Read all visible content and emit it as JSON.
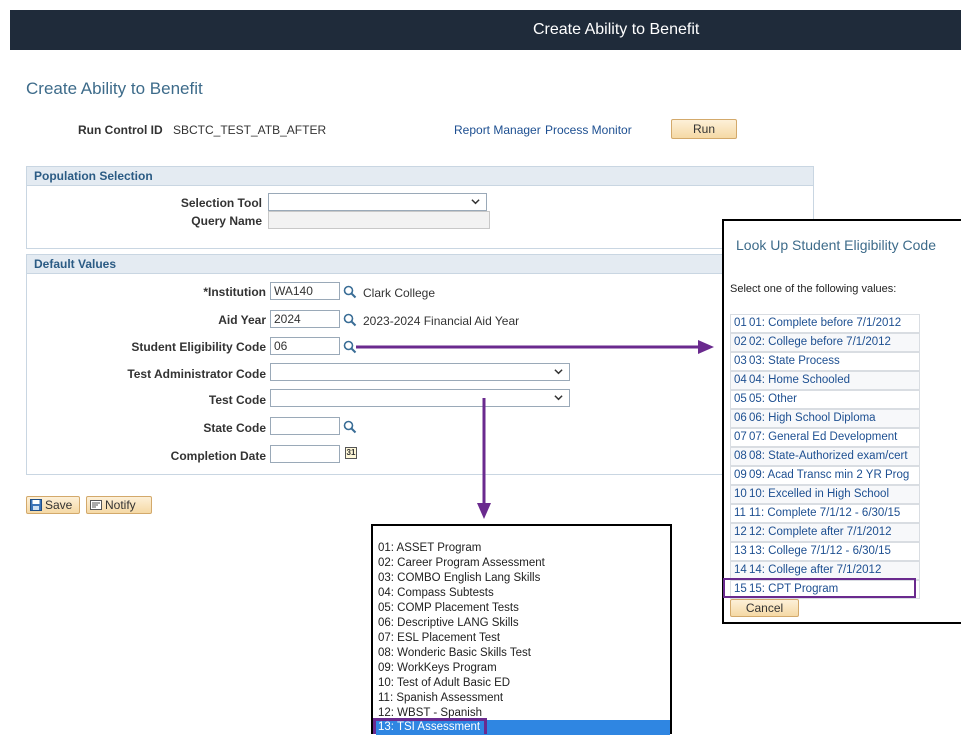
{
  "banner": {
    "title": "Create Ability to Benefit"
  },
  "page": {
    "title": "Create Ability to Benefit"
  },
  "run_control": {
    "label": "Run Control ID",
    "value": "SBCTC_TEST_ATB_AFTER",
    "report_manager": "Report Manager",
    "process_monitor": "Process Monitor",
    "run_label": "Run"
  },
  "population": {
    "header": "Population Selection",
    "selection_tool_label": "Selection Tool",
    "selection_tool_value": "",
    "query_name_label": "Query Name",
    "query_name_value": ""
  },
  "defaults": {
    "header": "Default Values",
    "institution_label": "*Institution",
    "institution_value": "WA140",
    "institution_desc": "Clark College",
    "aid_year_label": "Aid Year",
    "aid_year_value": "2024",
    "aid_year_desc": "2023-2024 Financial Aid Year",
    "eligibility_label": "Student Eligibility Code",
    "eligibility_value": "06",
    "test_admin_label": "Test Administrator Code",
    "test_admin_value": "",
    "test_code_label": "Test Code",
    "test_code_value": "",
    "state_code_label": "State Code",
    "state_code_value": "",
    "completion_label": "Completion Date",
    "completion_value": "",
    "calendar_glyph": "31"
  },
  "actions": {
    "save": "Save",
    "notify": "Notify"
  },
  "test_code_options": [
    "01: ASSET Program",
    "02: Career Program Assessment",
    "03: COMBO English Lang Skills",
    "04: Compass Subtests",
    "05: COMP Placement Tests",
    "06: Descriptive LANG Skills",
    "07: ESL Placement Test",
    "08: Wonderic Basic Skills Test",
    "09: WorkKeys Program",
    "10: Test of Adult Basic ED",
    "11: Spanish Assessment",
    "12: WBST - Spanish",
    "13: TSI Assessment"
  ],
  "lookup": {
    "title": "Look Up Student Eligibility Code",
    "instruction": "Select one of the following values:",
    "rows": [
      {
        "code": "01",
        "desc": "01: Complete before 7/1/2012"
      },
      {
        "code": "02",
        "desc": "02: College before 7/1/2012"
      },
      {
        "code": "03",
        "desc": "03: State Process"
      },
      {
        "code": "04",
        "desc": "04: Home Schooled"
      },
      {
        "code": "05",
        "desc": "05: Other"
      },
      {
        "code": "06",
        "desc": "06: High School Diploma"
      },
      {
        "code": "07",
        "desc": "07: General Ed Development"
      },
      {
        "code": "08",
        "desc": "08: State-Authorized exam/cert"
      },
      {
        "code": "09",
        "desc": "09: Acad Transc min 2 YR Prog"
      },
      {
        "code": "10",
        "desc": "10: Excelled in High School"
      },
      {
        "code": "11",
        "desc": "11: Complete 7/1/12 - 6/30/15"
      },
      {
        "code": "12",
        "desc": "12: Complete after 7/1/2012"
      },
      {
        "code": "13",
        "desc": "13: College 7/1/12 - 6/30/15"
      },
      {
        "code": "14",
        "desc": "14: College after 7/1/2012"
      },
      {
        "code": "15",
        "desc": "15: CPT Program"
      }
    ],
    "cancel": "Cancel"
  },
  "colors": {
    "banner_bg": "#1f2b3a",
    "title_blue": "#3d6b8a",
    "link_blue": "#1d4f91",
    "annotation_purple": "#6a2a8e",
    "dropdown_highlight": "#2f86e2"
  }
}
